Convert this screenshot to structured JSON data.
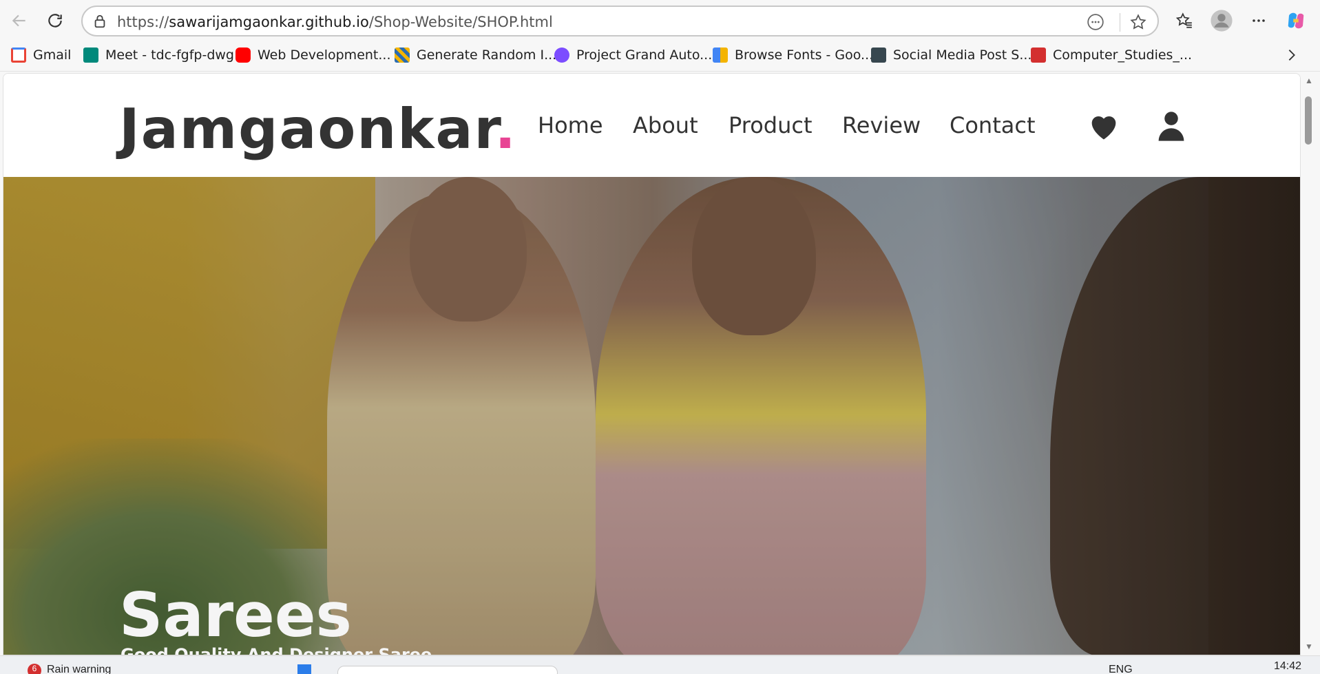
{
  "browser": {
    "url_prefix": "https://",
    "url_domain": "sawarijamgaonkar.github.io",
    "url_path": "/Shop-Website/SHOP.html",
    "bookmarks": [
      {
        "label": "Gmail",
        "color": "#ea4335"
      },
      {
        "label": "Meet - tdc-fgfp-dwg",
        "color": "#00897b"
      },
      {
        "label": "Web Development...",
        "color": "#ff0000"
      },
      {
        "label": "Generate Random I...",
        "color": "#2b6cb0"
      },
      {
        "label": "Project Grand Auto...",
        "color": "#7c4dff"
      },
      {
        "label": "Browse Fonts - Goo...",
        "color": "#f4b400"
      },
      {
        "label": "Social Media Post S...",
        "color": "#37474f"
      },
      {
        "label": "Computer_Studies_...",
        "color": "#d32f2f"
      }
    ]
  },
  "site": {
    "logo_text": "Jamgaonkar",
    "logo_dot": ".",
    "accent": "#e84393",
    "nav": [
      "Home",
      "About",
      "Product",
      "Review",
      "Contact"
    ],
    "icons": [
      "heart-icon",
      "user-icon"
    ]
  },
  "hero": {
    "title": "Sarees",
    "subtitle": "Good Quality And Designer Saree"
  },
  "taskbar": {
    "weather": "Rain warning",
    "weather_badge": "6",
    "lang": "ENG",
    "time": "14:42"
  }
}
